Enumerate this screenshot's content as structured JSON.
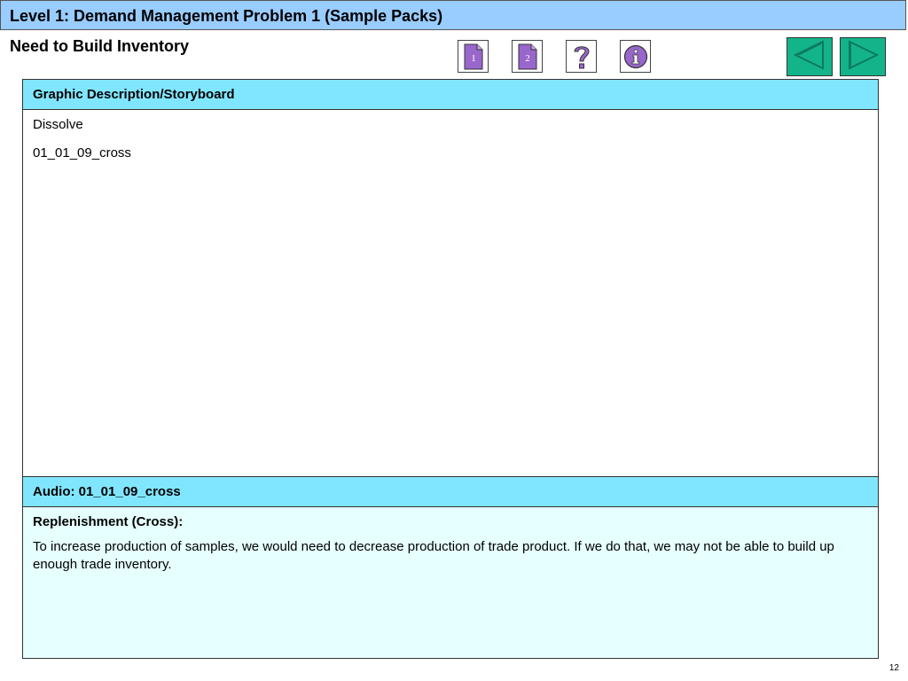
{
  "slide": {
    "title": "Level 1: Demand Management Problem 1 (Sample Packs)",
    "subtitle": "Need to Build Inventory",
    "page_number": "12"
  },
  "nav": {
    "buttons": [
      {
        "icon": "page-1-icon",
        "label": "1"
      },
      {
        "icon": "page-2-icon",
        "label": "2"
      },
      {
        "icon": "question-mark-icon"
      },
      {
        "icon": "info-icon"
      }
    ],
    "prev_icon": "left-arrow-icon",
    "next_icon": "right-arrow-icon"
  },
  "graphic": {
    "header": "Graphic Description/Storyboard",
    "lines": [
      "Dissolve",
      "01_01_09_cross"
    ]
  },
  "audio": {
    "header": "Audio: 01_01_09_cross",
    "heading": "Replenishment (Cross):",
    "text": "To increase production of samples, we would need to decrease production of trade product. If we do that, we may not be able to build up enough trade inventory."
  },
  "colors": {
    "title_bar": "#99ccff",
    "panel_header": "#80e6ff",
    "audio_body": "#e6ffff",
    "nav_purple": "#9966cc",
    "arrow_green": "#13b48a",
    "arrow_dark": "#0d7a5e"
  }
}
